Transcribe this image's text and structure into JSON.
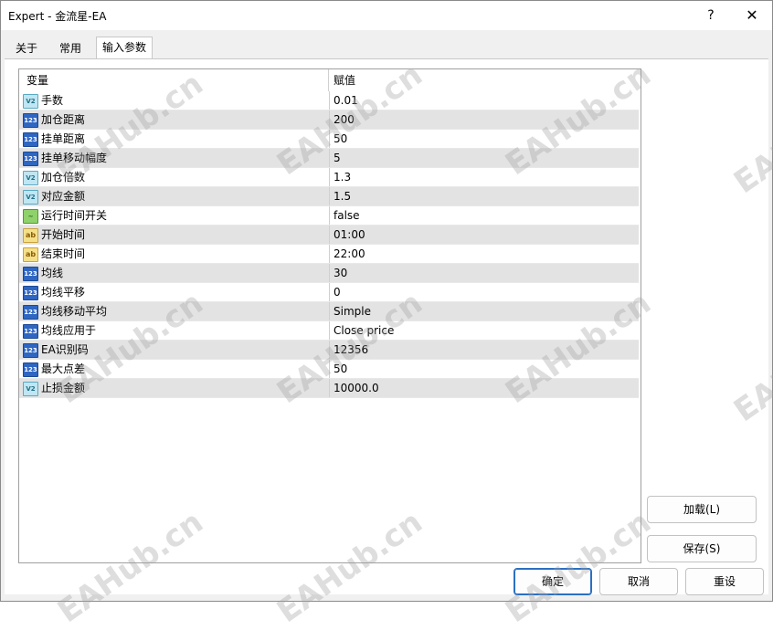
{
  "window": {
    "title": "Expert - 金流星-EA"
  },
  "titlebar": {
    "help": "?",
    "close": "✕"
  },
  "tabs": [
    {
      "label": "关于"
    },
    {
      "label": "常用"
    },
    {
      "label": "输入参数",
      "active": true
    }
  ],
  "grid": {
    "headers": {
      "variable": "变量",
      "value": "赋值"
    },
    "rows": [
      {
        "icon": "V2",
        "type": "dbl",
        "name": "手数",
        "value": "0.01"
      },
      {
        "icon": "123",
        "type": "int",
        "name": "加仓距离",
        "value": "200"
      },
      {
        "icon": "123",
        "type": "int",
        "name": "挂单距离",
        "value": "50"
      },
      {
        "icon": "123",
        "type": "int",
        "name": "挂单移动幅度",
        "value": "5"
      },
      {
        "icon": "V2",
        "type": "dbl",
        "name": "加仓倍数",
        "value": "1.3"
      },
      {
        "icon": "V2",
        "type": "dbl",
        "name": "对应金额",
        "value": "1.5"
      },
      {
        "icon": "~",
        "type": "bool",
        "name": "运行时间开关",
        "value": "false"
      },
      {
        "icon": "ab",
        "type": "str",
        "name": "开始时间",
        "value": "01:00"
      },
      {
        "icon": "ab",
        "type": "str",
        "name": "结束时间",
        "value": "22:00"
      },
      {
        "icon": "123",
        "type": "int",
        "name": "均线",
        "value": "30"
      },
      {
        "icon": "123",
        "type": "int",
        "name": "均线平移",
        "value": "0"
      },
      {
        "icon": "123",
        "type": "int",
        "name": "均线移动平均",
        "value": "Simple"
      },
      {
        "icon": "123",
        "type": "int",
        "name": "均线应用于",
        "value": "Close price"
      },
      {
        "icon": "123",
        "type": "int",
        "name": "EA识别码",
        "value": "12356"
      },
      {
        "icon": "123",
        "type": "int",
        "name": "最大点差",
        "value": "50"
      },
      {
        "icon": "V2",
        "type": "dbl",
        "name": "止损金额",
        "value": "10000.0"
      }
    ]
  },
  "buttons": {
    "load": "加载(L)",
    "save": "保存(S)",
    "ok": "确定",
    "cancel": "取消",
    "reset": "重设"
  },
  "watermark": "EAHub.cn"
}
